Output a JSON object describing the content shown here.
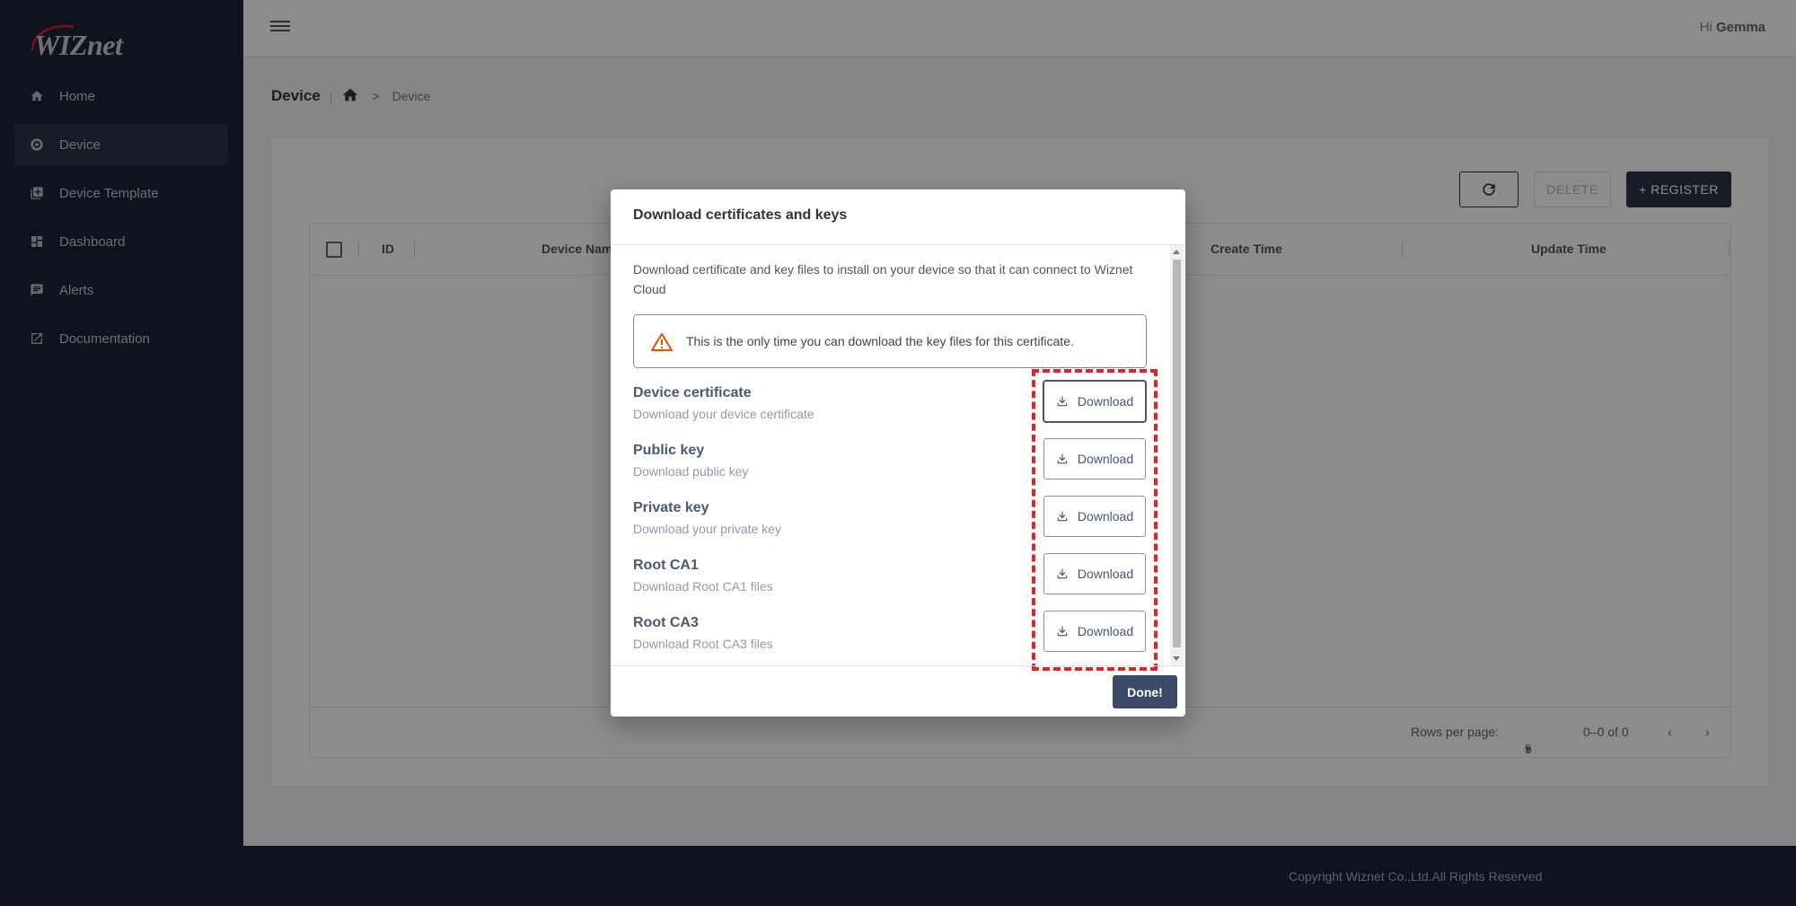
{
  "brand": {
    "logo_text": "WIZnet"
  },
  "sidebar": {
    "items": [
      {
        "label": "Home",
        "icon": "home-icon"
      },
      {
        "label": "Device",
        "icon": "device-icon"
      },
      {
        "label": "Device Template",
        "icon": "template-icon"
      },
      {
        "label": "Dashboard",
        "icon": "dashboard-icon"
      },
      {
        "label": "Alerts",
        "icon": "alert-icon"
      },
      {
        "label": "Documentation",
        "icon": "external-link-icon"
      }
    ]
  },
  "topbar": {
    "greeting_prefix": "Hi",
    "user_name": "Gemma"
  },
  "breadcrumb": {
    "title": "Device",
    "current": "Device"
  },
  "toolbar": {
    "delete_label": "DELETE",
    "register_label": "+ REGISTER"
  },
  "table": {
    "columns": [
      "ID",
      "Device Name",
      "Create Time",
      "Update Time"
    ],
    "footer": {
      "rows_per_page_label": "Rows per page:",
      "rows_per_page_value": "5",
      "range": "0–0 of 0"
    }
  },
  "footer": {
    "copyright": "Copyright Wiznet Co.,Ltd.All Rights Reserved"
  },
  "modal": {
    "title": "Download certificates and keys",
    "description": "Download certificate and key files to install on your device so that it can connect to Wiznet Cloud",
    "warning": "This is the only time you can download the key files for this certificate.",
    "items": [
      {
        "title": "Device certificate",
        "subtitle": "Download your device certificate",
        "button": "Download"
      },
      {
        "title": "Public key",
        "subtitle": "Download public key",
        "button": "Download"
      },
      {
        "title": "Private key",
        "subtitle": "Download your private key",
        "button": "Download"
      },
      {
        "title": "Root CA1",
        "subtitle": "Download Root CA1 files",
        "button": "Download"
      },
      {
        "title": "Root CA3",
        "subtitle": "Download Root CA3 files",
        "button": "Download"
      }
    ],
    "done_label": "Done!"
  },
  "colors": {
    "sidebar_bg": "#1b2438",
    "primary": "#2b3346",
    "warning": "#e65100",
    "highlight": "#e0242b"
  }
}
